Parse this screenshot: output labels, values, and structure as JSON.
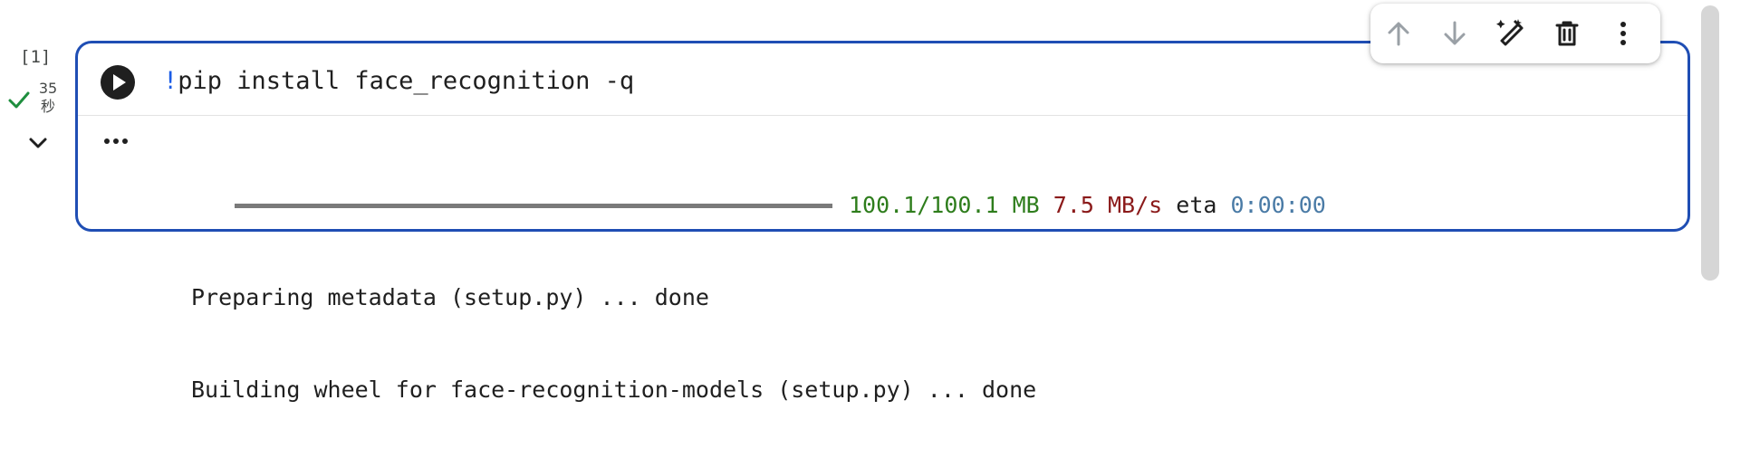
{
  "gutter": {
    "execution_count": "[1]",
    "duration_value": "35",
    "duration_unit": "秒",
    "status_icon": "check-icon",
    "collapse_icon": "chevron-down-icon"
  },
  "cell": {
    "run_icon": "play-icon",
    "code_prefix": "!",
    "code_text": "pip install face_recognition -q",
    "output_menu_icon": "more-horizontal-icon",
    "output": {
      "progress_size": "100.1/100.1 MB",
      "progress_speed": "7.5 MB/s",
      "progress_eta_label": "eta",
      "progress_eta_value": "0:00:00",
      "line2": "Preparing metadata (setup.py) ... done",
      "line3": "Building wheel for face-recognition-models (setup.py) ... done"
    }
  },
  "toolbar": {
    "items": [
      "arrow-up-icon",
      "arrow-down-icon",
      "magic-edit-icon",
      "trash-icon",
      "more-vertical-icon"
    ]
  },
  "colors": {
    "accent_border": "#1f4eb4",
    "success": "#2e7d1c",
    "speed": "#8b1a1a",
    "eta": "#4a7ba6",
    "bang": "#1a5ce6"
  }
}
